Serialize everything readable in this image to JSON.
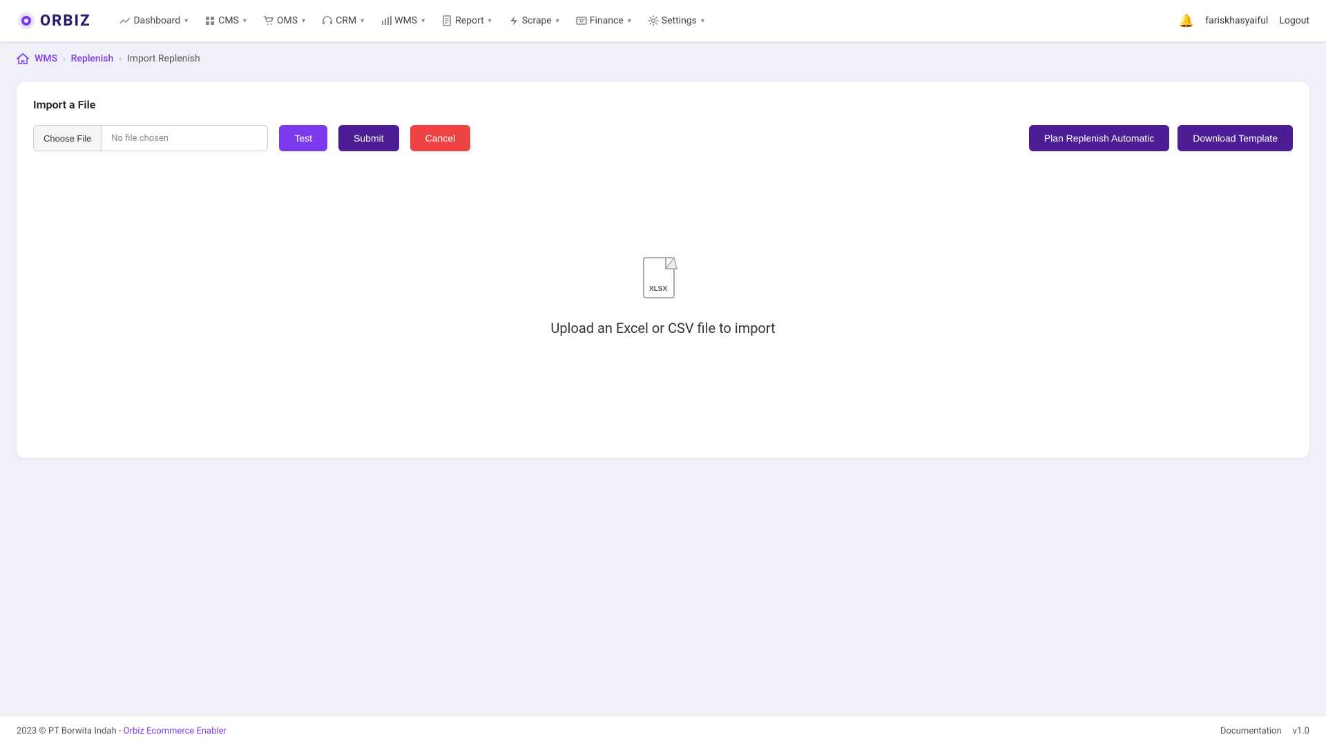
{
  "brand": {
    "name": "ORBIZ"
  },
  "navbar": {
    "items": [
      {
        "id": "dashboard",
        "label": "Dashboard",
        "icon": "chart-icon"
      },
      {
        "id": "cms",
        "label": "CMS",
        "icon": "cms-icon"
      },
      {
        "id": "oms",
        "label": "OMS",
        "icon": "cart-icon"
      },
      {
        "id": "crm",
        "label": "CRM",
        "icon": "headset-icon"
      },
      {
        "id": "wms",
        "label": "WMS",
        "icon": "bar-chart-icon"
      },
      {
        "id": "report",
        "label": "Report",
        "icon": "file-icon"
      },
      {
        "id": "scrape",
        "label": "Scrape",
        "icon": "bolt-icon"
      },
      {
        "id": "finance",
        "label": "Finance",
        "icon": "finance-icon"
      },
      {
        "id": "settings",
        "label": "Settings",
        "icon": "gear-icon"
      }
    ],
    "username": "fariskhasyaiful",
    "logout_label": "Logout"
  },
  "breadcrumb": {
    "home_label": "WMS",
    "parent_label": "Replenish",
    "current_label": "Import Replenish"
  },
  "page": {
    "card_title": "Import a File",
    "choose_file_label": "Choose File",
    "no_file_label": "No file chosen",
    "test_button": "Test",
    "submit_button": "Submit",
    "cancel_button": "Cancel",
    "plan_replenish_button": "Plan Replenish Automatic",
    "download_template_button": "Download Template",
    "drop_zone_text": "Upload an Excel or CSV file to import",
    "xlsx_label": "XLSX"
  },
  "footer": {
    "copyright": "2023 © PT Borwita Indah - ",
    "brand_link_label": "Orbiz Ecommerce Enabler",
    "documentation_label": "Documentation",
    "version_label": "v1.0"
  }
}
